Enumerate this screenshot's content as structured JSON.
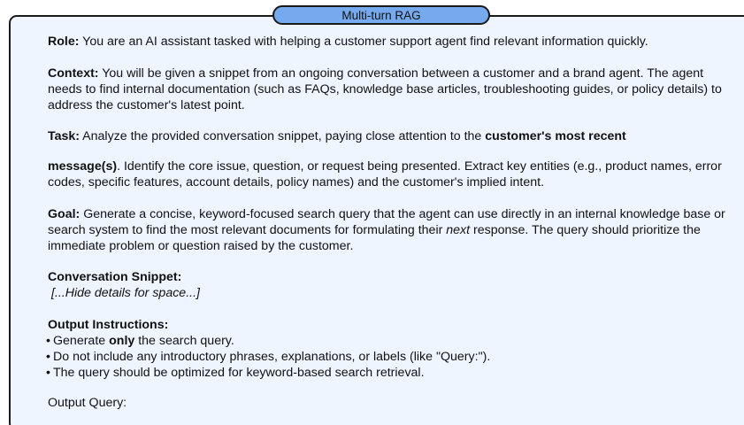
{
  "title": "Multi-turn RAG",
  "role": {
    "label": "Role:",
    "text": " You are an AI assistant tasked with helping a customer support agent find relevant information quickly."
  },
  "context": {
    "label": "Context:",
    "text": " You will be given a snippet from an ongoing conversation between a customer and a brand agent. The agent needs to find internal documentation (such as FAQs, knowledge base articles, troubleshooting guides, or policy details) to address the customer's latest point."
  },
  "task": {
    "label": "Task:",
    "text_before": " Analyze the provided conversation snippet, paying close attention to the ",
    "bold_phrase": "customer's most recent",
    "bold_continued": "message(s)",
    "text_after": ". Identify the core issue, question, or request being presented. Extract key entities (e.g., product names, error codes, specific features, account details, policy names) and the customer's implied intent."
  },
  "goal": {
    "label": "Goal:",
    "text_before": " Generate a concise, keyword-focused search query that the agent can use directly in an internal knowledge base or search system to find the most relevant documents for formulating their ",
    "italic_word": "next",
    "text_after": " response. The query should prioritize the immediate problem or question raised by the customer."
  },
  "snippet": {
    "heading": "Conversation Snippet:",
    "body": "[...Hide details for space...]"
  },
  "output_instructions": {
    "heading": "Output Instructions:",
    "item1_before": "Generate ",
    "item1_bold": "only",
    "item1_after": " the search query.",
    "item2": "Do not include any introductory phrases, explanations, or labels (like \"Query:\").",
    "item3": "The query should be optimized for keyword-based search retrieval."
  },
  "output_query_label": "Output Query:"
}
